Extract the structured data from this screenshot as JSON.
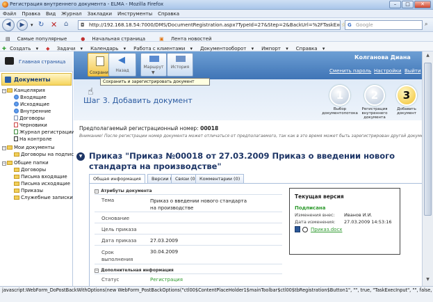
{
  "window": {
    "title": "Регистрация внутреннего документа - ELMA - Mozilla Firefox"
  },
  "menu": [
    "Файл",
    "Правка",
    "Вид",
    "Журнал",
    "Закладки",
    "Инструменты",
    "Справка"
  ],
  "nav": {
    "url": "http://192.168.18.54:7000/DMS/DocumentRegistration.aspx?TypeId=27&Step=2&BackUrl=%2FTaskExec.aspx%",
    "search_placeholder": "Google"
  },
  "bookmarks": [
    "Самые популярные",
    "Начальная страница",
    "Лента новостей"
  ],
  "app_toolbar": [
    "Создать",
    "Задачи",
    "Календарь",
    "Работа с клиентами",
    "Документооборот",
    "Импорт",
    "Справка"
  ],
  "sidebar": {
    "home": "Главная страница",
    "section": "Документы",
    "tree": {
      "kanc": "Канцелярия",
      "vhod": "Входящие",
      "ishod": "Исходящие",
      "vnutr": "Внутренние",
      "dogov": "Договоры",
      "chern": "Черновики",
      "jurnal": "Журнал регистрации",
      "nakontr": "На контроле",
      "moi": "Мои документы",
      "dogpodp": "Договоры на подпись",
      "obsh": "Общие папки",
      "dog2": "Договоры",
      "pisvh": "Письма входящие",
      "pisish": "Письма исходящие",
      "prik": "Приказы",
      "sluzh": "Служебные записки"
    }
  },
  "toolbar": {
    "save": "Сохранить",
    "back": "Назад",
    "route": "Маршрут",
    "history": "История"
  },
  "tooltip": "Сохранить и зарегистрировать документ",
  "user": {
    "name": "Колганова Диана",
    "change_pwd": "Сменить пароль",
    "settings": "Настройки",
    "logout": "Выйти"
  },
  "step": {
    "title": "Шаг 3.  Добавить документ",
    "steps": [
      {
        "n": "1",
        "label": "Выбор документопотока"
      },
      {
        "n": "2",
        "label": "Регистрация внутреннего документа"
      },
      {
        "n": "3",
        "label": "Добавить документ"
      }
    ]
  },
  "regnum": {
    "label": "Предполагаемый регистрационный номер:",
    "value": "00018"
  },
  "warning": "Внимание! После регистрации номер документа может отличаться от предполагаемого, так как в это время может быть зарегистрирован другой документ.",
  "doc_title": "Приказ \"Приказ №00018 от 27.03.2009 Приказ о введении нового стандарта на производстве\"",
  "tabs": [
    "Общая информация",
    "Версии (1)",
    "Связи (0)",
    "Комментарии (0)"
  ],
  "attrs": {
    "section": "Атрибуты документа",
    "tema_label": "Тема",
    "tema_value": "Приказ о введении нового стандарта на производстве",
    "osn_label": "Основание",
    "cel_label": "Цель приказа",
    "date_label": "Дата приказа",
    "date_value": "27.03.2009",
    "srok_label": "Срок выполнения",
    "srok_value": "30.04.2009"
  },
  "extra": {
    "section": "Дополнительная информация",
    "status_label": "Статус",
    "status_value": "Регистрация"
  },
  "current_version": {
    "title": "Текущая версия",
    "signed": "Подписана",
    "changed_by_label": "Изменения внес:",
    "changed_by": "Иванов И.И.",
    "date_label": "Дата изменения:",
    "date": "27.03.2009 14:53:16",
    "file": "Приказ.docx"
  },
  "statusbar": "javascript:WebForm_DoPostBackWithOptions(new WebForm_PostBackOptions(\"ctl00$ContentPlaceHolder1$mainToolbar$ctl00$tbRegistration$Button1\", \"\", true, \"TaskExecInput\", \"\", false, true))",
  "colors": {
    "accent": "#3f74b6",
    "signed": "#2e9a2e",
    "status": "#2e9a2e"
  }
}
